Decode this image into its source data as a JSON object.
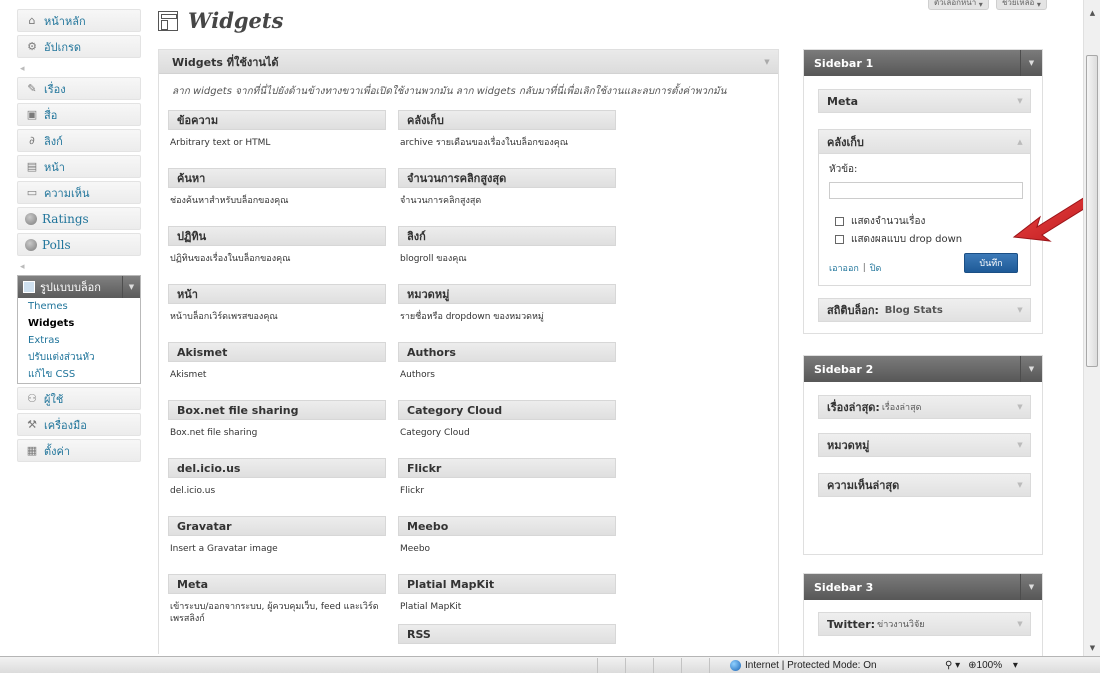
{
  "admin_menu": {
    "dashboard": "หน้าหลัก",
    "updates": "อัปเกรด",
    "posts": "เรื่อง",
    "media": "สื่อ",
    "links": "ลิงก์",
    "pages": "หน้า",
    "comments": "ความเห็น",
    "ratings": "Ratings",
    "polls": "Polls",
    "appearance": "รูปแบบบล็อก",
    "appearance_submenu": [
      "Themes",
      "Widgets",
      "Extras",
      "ปรับแต่งส่วนหัว",
      "แก้ไข CSS"
    ],
    "users": "ผู้ใช้",
    "tools": "เครื่องมือ",
    "settings": "ตั้งค่า"
  },
  "page": {
    "title": "Widgets",
    "screen_options": "ตัวเลือกหน้า",
    "help": "ช่วยเหลือ"
  },
  "available": {
    "title": "Widgets ที่ใช้งานได้",
    "description": "ลาก widgets จากที่นี่ไปยังด้านข้างทางขวาเพื่อเปิดใช้งานพวกมัน ลาก widgets กลับมาที่นี่เพื่อเลิกใช้งานและลบการตั้งค่าพวกมัน",
    "widgets": [
      {
        "title": "ข้อความ",
        "desc": "Arbitrary text or HTML"
      },
      {
        "title": "คลังเก็บ",
        "desc": "archive รายเดือนของเรื่องในบล็อกของคุณ"
      },
      {
        "title": "ค้นหา",
        "desc": "ช่องค้นหาสำหรับบล็อกของคุณ"
      },
      {
        "title": "จำนวนการคลิกสูงสุด",
        "desc": "จำนวนการคลิกสูงสุด"
      },
      {
        "title": "ปฏิทิน",
        "desc": "ปฏิทินของเรื่องในบล็อกของคุณ"
      },
      {
        "title": "ลิงก์",
        "desc": "blogroll ของคุณ"
      },
      {
        "title": "หน้า",
        "desc": "หน้าบล็อกเวิร์ดเพรสของคุณ"
      },
      {
        "title": "หมวดหมู่",
        "desc": "รายชื่อหรือ  dropdown ของหมวดหมู่"
      },
      {
        "title": "Akismet",
        "desc": "Akismet"
      },
      {
        "title": "Authors",
        "desc": "Authors"
      },
      {
        "title": "Box.net file sharing",
        "desc": "Box.net file sharing"
      },
      {
        "title": "Category Cloud",
        "desc": "Category Cloud"
      },
      {
        "title": "del.icio.us",
        "desc": "del.icio.us"
      },
      {
        "title": "Flickr",
        "desc": "Flickr"
      },
      {
        "title": "Gravatar",
        "desc": "Insert a Gravatar image"
      },
      {
        "title": "Meebo",
        "desc": "Meebo"
      },
      {
        "title": "Meta",
        "desc": "เข้าระบบ/ออกจากระบบ, ผู้ควบคุมเว็บ, feed และเวิร์ดเพรสลิงก์"
      },
      {
        "title": "Platial MapKit",
        "desc": "Platial MapKit"
      },
      {
        "title": "",
        "desc": ""
      },
      {
        "title": "RSS",
        "desc": ""
      }
    ]
  },
  "sidebar1": {
    "title": "Sidebar 1",
    "meta_widget": "Meta",
    "archive_widget": {
      "title": "คลังเก็บ",
      "field_label": "หัวข้อ:",
      "field_value": "",
      "option_count": "แสดงจำนวนเรื่อง",
      "option_dropdown": "แสดงผลแบบ  drop down",
      "remove": "เอาออก",
      "close": "ปิด",
      "save": "บันทึก"
    },
    "stats_widget": "สถิติบล็อก",
    "stats_widget_sub": "Blog Stats"
  },
  "sidebar2": {
    "title": "Sidebar 2",
    "widgets": [
      {
        "title": "เรื่องล่าสุด",
        "sub": "เรื่องล่าสุด"
      },
      {
        "title": "หมวดหมู่",
        "sub": ""
      },
      {
        "title": "ความเห็นล่าสุด",
        "sub": ""
      }
    ]
  },
  "sidebar3": {
    "title": "Sidebar 3",
    "widgets": [
      {
        "title": "Twitter",
        "sub": "ข่าวงานวิจัย"
      }
    ]
  },
  "statusbar": {
    "zone": "Internet | Protected Mode: On",
    "zoom": "100%"
  },
  "colors": {
    "link": "#21759b",
    "sidebar_head": "#666666",
    "save_button": "#2a6aa8",
    "annotation_arrow": "#d8262a"
  }
}
